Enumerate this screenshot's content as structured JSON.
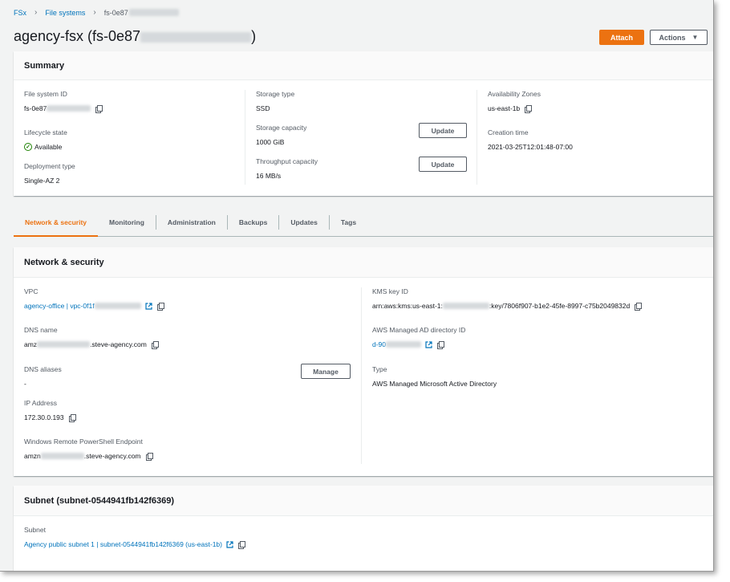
{
  "breadcrumb": {
    "item1": "FSx",
    "item2": "File systems",
    "current": "fs-0e87"
  },
  "header": {
    "title": "agency-fsx (fs-0e87",
    "title_end": ")",
    "attach_label": "Attach",
    "actions_label": "Actions"
  },
  "summary": {
    "heading": "Summary",
    "fs_id_label": "File system ID",
    "fs_id_value": "fs-0e87",
    "lifecycle_label": "Lifecycle state",
    "lifecycle_value": "Available",
    "deploy_label": "Deployment type",
    "deploy_value": "Single-AZ 2",
    "storage_type_label": "Storage type",
    "storage_type_value": "SSD",
    "storage_cap_label": "Storage capacity",
    "storage_cap_value": "1000 GiB",
    "throughput_label": "Throughput capacity",
    "throughput_value": "16 MB/s",
    "update_label": "Update",
    "az_label": "Availability Zones",
    "az_value": "us-east-1b",
    "created_label": "Creation time",
    "created_value": "2021-03-25T12:01:48-07:00"
  },
  "tabs": [
    "Network & security",
    "Monitoring",
    "Administration",
    "Backups",
    "Updates",
    "Tags"
  ],
  "network": {
    "heading": "Network & security",
    "vpc_label": "VPC",
    "vpc_value": "agency-office | vpc-0f1f",
    "dns_label": "DNS name",
    "dns_prefix": "amz",
    "dns_suffix": ".steve-agency.com",
    "aliases_label": "DNS aliases",
    "aliases_value": "-",
    "manage_label": "Manage",
    "ip_label": "IP Address",
    "ip_value": "172.30.0.193",
    "ps_label": "Windows Remote PowerShell Endpoint",
    "ps_prefix": "amzn",
    "ps_suffix": ".steve-agency.com",
    "kms_label": "KMS key ID",
    "kms_prefix": "arn:aws:kms:us-east-1:",
    "kms_suffix": ":key/7806f907-b1e2-45fe-8997-c75b2049832d",
    "ad_label": "AWS Managed AD directory ID",
    "ad_value": "d-90",
    "type_label": "Type",
    "type_value": "AWS Managed Microsoft Active Directory"
  },
  "subnet": {
    "heading": "Subnet (subnet-0544941fb142f6369)",
    "label": "Subnet",
    "value": "Agency public subnet 1 | subnet-0544941fb142f6369 (us-east-1b)"
  },
  "colors": {
    "accent": "#ec7211",
    "link": "#0073bb",
    "success": "#1d8102"
  }
}
